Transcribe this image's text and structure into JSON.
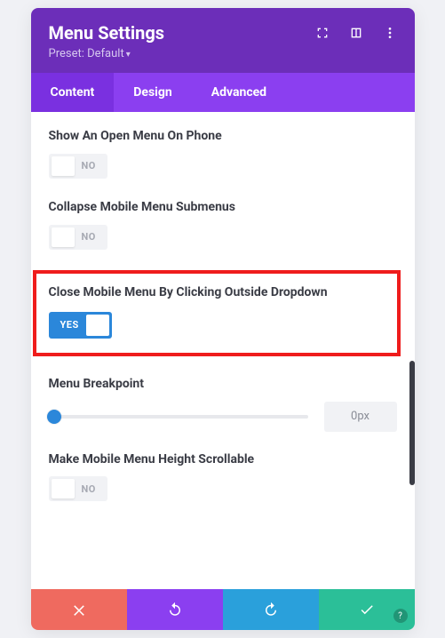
{
  "header": {
    "title": "Menu Settings",
    "preset_label": "Preset: Default",
    "icons": [
      "expand-icon",
      "responsive-icon",
      "kebab-icon"
    ]
  },
  "tabs": [
    {
      "label": "Content",
      "active": true
    },
    {
      "label": "Design",
      "active": false
    },
    {
      "label": "Advanced",
      "active": false
    }
  ],
  "settings": {
    "show_open_menu_phone": {
      "label": "Show An Open Menu On Phone",
      "value": "NO"
    },
    "collapse_submenus": {
      "label": "Collapse Mobile Menu Submenus",
      "value": "NO"
    },
    "close_outside": {
      "label": "Close Mobile Menu By Clicking Outside Dropdown",
      "value": "YES"
    },
    "menu_breakpoint": {
      "label": "Menu Breakpoint",
      "value": "0px"
    },
    "height_scrollable": {
      "label": "Make Mobile Menu Height Scrollable",
      "value": "NO"
    }
  },
  "footer": {
    "buttons": [
      "cancel",
      "undo",
      "redo",
      "save"
    ]
  }
}
